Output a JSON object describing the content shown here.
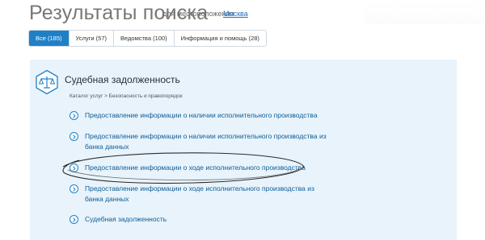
{
  "header": {
    "title": "Результаты поиска",
    "location_label": "для местоположения",
    "location_value": "Москва"
  },
  "tabs": [
    {
      "label": "Все (185)",
      "active": true
    },
    {
      "label": "Услуги (57)",
      "active": false
    },
    {
      "label": "Ведомства (100)",
      "active": false
    },
    {
      "label": "Информация и помощь (28)",
      "active": false
    }
  ],
  "result": {
    "icon": "scales-icon",
    "title": "Судебная задолженность",
    "breadcrumb": "Каталог услуг > Безопасность и правопорядок",
    "items": [
      "Предоставление информации о наличии исполнительного производства",
      "Предоставление информации о наличии исполнительного производства из банка данных",
      "Предоставление информации о ходе исполнительного производства",
      "Предоставление информации о ходе исполнительного производства из банка данных",
      "Судебная задолженность"
    ]
  },
  "colors": {
    "accent": "#1f80c7",
    "link": "#0e5c97",
    "panel": "#e8f3fb",
    "hand_drawn_circle": "#2b2b2b"
  }
}
